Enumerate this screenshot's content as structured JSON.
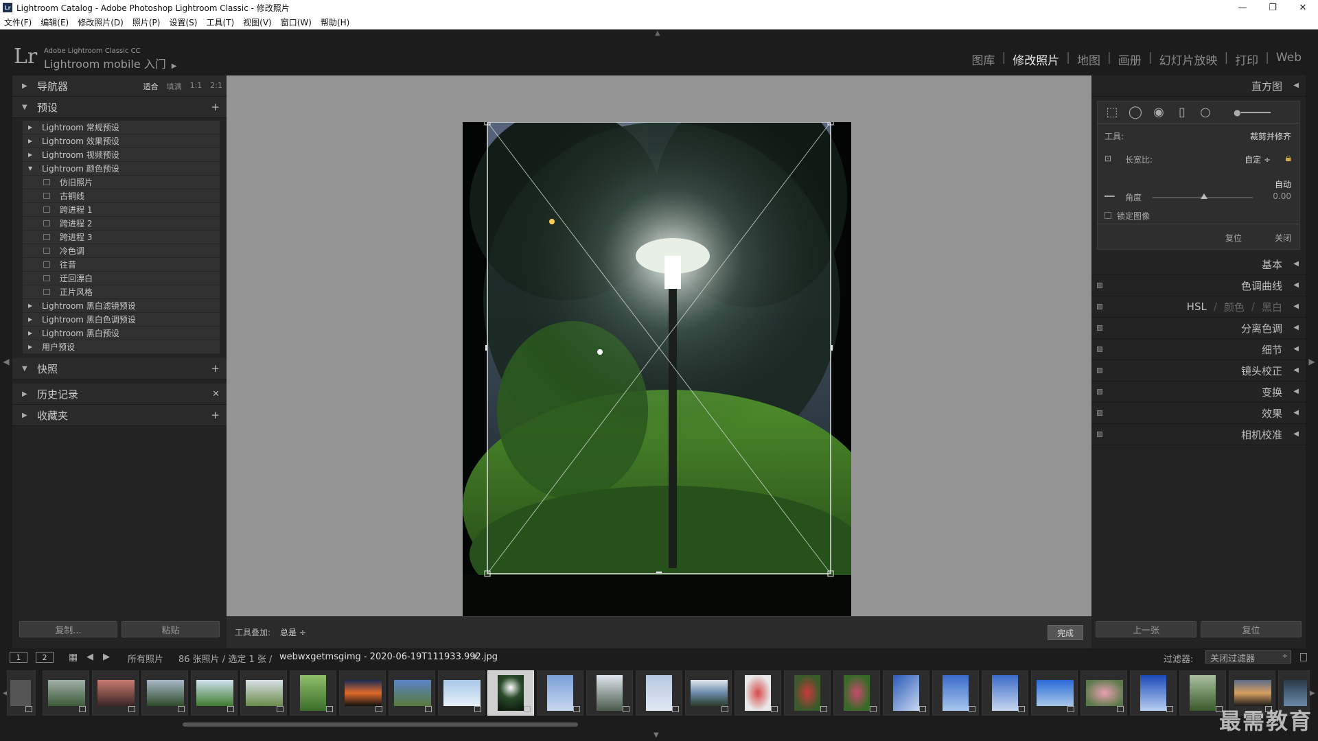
{
  "window": {
    "title": "Lightroom Catalog - Adobe Photoshop Lightroom Classic - 修改照片",
    "app_icon": "Lr",
    "controls": [
      "—",
      "❐",
      "✕"
    ]
  },
  "menu": [
    "文件(F)",
    "编辑(E)",
    "修改照片(D)",
    "照片(P)",
    "设置(S)",
    "工具(T)",
    "视图(V)",
    "窗口(W)",
    "帮助(H)"
  ],
  "identity": {
    "logo": "Lr",
    "product": "Adobe Lightroom Classic CC",
    "mobile": "Lightroom mobile 入门"
  },
  "modules": [
    "图库",
    "修改照片",
    "地图",
    "画册",
    "幻灯片放映",
    "打印",
    "Web"
  ],
  "active_module": "修改照片",
  "left": {
    "navigator": {
      "label": "导航器",
      "opts": [
        "适合",
        "填满",
        "1:1",
        "2:1"
      ]
    },
    "presets": {
      "label": "预设",
      "groups_before": [
        "Lightroom 常规预设",
        "Lightroom 效果预设",
        "Lightroom 视频预设"
      ],
      "open_group": "Lightroom 颜色预设",
      "open_items": [
        "仿旧照片",
        "古铜线",
        "跨进程 1",
        "跨进程 2",
        "跨进程 3",
        "冷色调",
        "往昔",
        "迂回漂白",
        "正片风格"
      ],
      "groups_after": [
        "Lightroom 黑白滤镜预设",
        "Lightroom 黑白色调预设",
        "Lightroom 黑白预设",
        "用户预设"
      ]
    },
    "snapshots": "快照",
    "history": "历史记录",
    "collections": "收藏夹",
    "copy_btn": "复制...",
    "paste_btn": "粘贴"
  },
  "toolbar": {
    "overlay_label": "工具叠加:",
    "overlay_value": "总是 ÷",
    "done": "完成"
  },
  "right": {
    "histogram": "直方图",
    "crop": {
      "tool_label": "工具:",
      "tool_value": "裁剪并修齐",
      "aspect_label": "长宽比:",
      "aspect_value": "自定 ÷",
      "auto": "自动",
      "angle_label": "角度",
      "angle_value": "0.00",
      "lock_label": "锁定图像",
      "reset": "复位",
      "close": "关闭"
    },
    "panels": [
      "基本",
      "色调曲线",
      "分离色调",
      "细节",
      "镜头校正",
      "变换",
      "效果",
      "相机校准"
    ],
    "hsl": [
      "HSL",
      "颜色",
      "黑白"
    ],
    "prev_btn": "上一张",
    "reset_btn": "复位"
  },
  "filmstrip": {
    "view1": "1",
    "view2": "2",
    "source": "所有照片",
    "count": "86 张照片 / 选定 1 张 /",
    "filename": "webwxgetmsgimg - 2020-06-19T111933.992.jpg",
    "filter_label": "过滤器:",
    "filter_value": "关闭过滤器",
    "watermark": "最需教育"
  },
  "colors": {
    "accent": "#e8e8e8",
    "panel": "#232323",
    "canvas": "#949494"
  }
}
